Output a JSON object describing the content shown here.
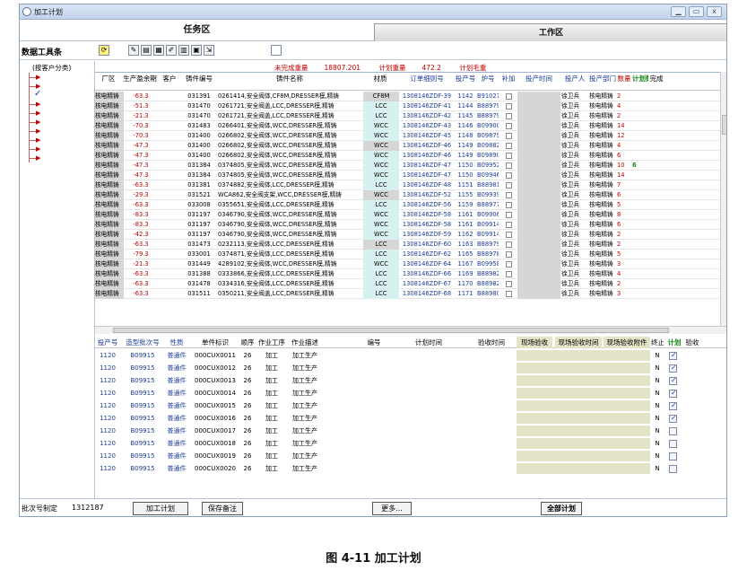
{
  "window": {
    "title": "加工计划",
    "controls": [
      "minimize-icon",
      "restore-icon",
      "close-icon"
    ]
  },
  "panes": {
    "task": "任务区",
    "work": "工作区"
  },
  "toolbar": {
    "label": "数据工具条"
  },
  "tree": {
    "header": "(按客户分类)"
  },
  "summary": {
    "unfinished_label": "未完成重量",
    "unfinished_value": "18807.201",
    "plan_label": "计划重量",
    "plan_value": "472.2",
    "blank_label": "计划毛重"
  },
  "grid1": {
    "headers": [
      "厂区",
      "生产盈余期",
      "客户",
      "铸件编号",
      "铸件名称",
      "材质",
      "订单细则号",
      "投产号",
      "炉号",
      "补加",
      "投产时间",
      "投产人",
      "投产部门",
      "数量",
      "计划数",
      "完成"
    ],
    "rows": [
      {
        "a": "核电精铸",
        "b": "-63.3",
        "d": "031391",
        "e": "0261414,安全阀体,CF8M,DRESSER模,精铸",
        "f": "CF8M",
        "g": "1308146ZDF-39",
        "h": "1142",
        "i": "B91027",
        "l": "徐卫兵",
        "m": "核电精铸",
        "n": "2",
        "o": "",
        "hl": "g"
      },
      {
        "a": "核电精铸",
        "b": "-51.3",
        "d": "031470",
        "e": "0261721,安全阀盖,LCC,DRESSER模,精铸",
        "f": "LCC",
        "g": "1308146ZDF-41",
        "h": "1144",
        "i": "B88979",
        "l": "徐卫兵",
        "m": "核电精铸",
        "n": "4",
        "o": "",
        "hl": "c"
      },
      {
        "a": "核电精铸",
        "b": "-21.3",
        "d": "031470",
        "e": "0261721,安全阀盖,LCC,DRESSER模,精铸",
        "f": "LCC",
        "g": "1308146ZDF-42",
        "h": "1145",
        "i": "B88979",
        "l": "徐卫兵",
        "m": "核电精铸",
        "n": "2",
        "o": "",
        "hl": "c"
      },
      {
        "a": "核电精铸",
        "b": "-70.3",
        "d": "031483",
        "e": "0266401,安全阀体,WCC,DRESSER模,精铸",
        "f": "WCC",
        "g": "1308146ZDF-43",
        "h": "1146",
        "i": "B09900",
        "l": "徐卫兵",
        "m": "核电精铸",
        "n": "14",
        "o": "",
        "hl": "c"
      },
      {
        "a": "核电精铸",
        "b": "-70.3",
        "d": "031400",
        "e": "0266802,安全阀体,WCC,DRESSER模,精铸",
        "f": "WCC",
        "g": "1308146ZDF-45",
        "h": "1148",
        "i": "B09879",
        "l": "徐卫兵",
        "m": "核电精铸",
        "n": "12",
        "o": "",
        "hl": "c"
      },
      {
        "a": "核电精铸",
        "b": "-47.3",
        "d": "031400",
        "e": "0266802,安全阀体,WCC,DRESSER模,精铸",
        "f": "WCC",
        "g": "1308146ZDF-46",
        "h": "1149",
        "i": "B09882",
        "l": "徐卫兵",
        "m": "核电精铸",
        "n": "4",
        "o": "",
        "hl": "g"
      },
      {
        "a": "核电精铸",
        "b": "-47.3",
        "d": "031400",
        "e": "0266802,安全阀体,WCC,DRESSER模,精铸",
        "f": "WCC",
        "g": "1308146ZDF-46",
        "h": "1149",
        "i": "B09890",
        "l": "徐卫兵",
        "m": "核电精铸",
        "n": "6",
        "o": "",
        "hl": "c"
      },
      {
        "a": "核电精铸",
        "b": "-47.3",
        "d": "031384",
        "e": "0374805,安全阀体,WCC,DRESSER模,精铸",
        "f": "WCC",
        "g": "1308146ZDF-47",
        "h": "1150",
        "i": "B09952",
        "l": "徐卫兵",
        "m": "核电精铸",
        "n": "10",
        "o": "6",
        "hl": "c"
      },
      {
        "a": "核电精铸",
        "b": "-47.3",
        "d": "031384",
        "e": "0374805,安全阀体,WCC,DRESSER模,精铸",
        "f": "WCC",
        "g": "1308146ZDF-47",
        "h": "1150",
        "i": "B09946",
        "l": "徐卫兵",
        "m": "核电精铸",
        "n": "14",
        "o": "",
        "hl": "c"
      },
      {
        "a": "核电精铸",
        "b": "-63.3",
        "d": "031381",
        "e": "0374882,安全阀体,LCC,DRESSER模,精铸",
        "f": "LCC",
        "g": "1308146ZDF-48",
        "h": "1151",
        "i": "B88981",
        "l": "徐卫兵",
        "m": "核电精铸",
        "n": "7",
        "o": "",
        "hl": "c"
      },
      {
        "a": "核电精铸",
        "b": "-29.3",
        "d": "031521",
        "e": "WCA862,安全阀支架,WCC,DRESSER模,精铸",
        "f": "WCC",
        "g": "1308146ZDF-52",
        "h": "1155",
        "i": "B09939",
        "l": "徐卫兵",
        "m": "核电精铸",
        "n": "6",
        "o": "",
        "hl": "g"
      },
      {
        "a": "核电精铸",
        "b": "-63.3",
        "d": "033008",
        "e": "0355651,安全阀体,LCC,DRESSER模,精铸",
        "f": "LCC",
        "g": "1308146ZDF-56",
        "h": "1159",
        "i": "B88977",
        "l": "徐卫兵",
        "m": "核电精铸",
        "n": "5",
        "o": "",
        "hl": "c"
      },
      {
        "a": "核电精铸",
        "b": "-83.3",
        "d": "031197",
        "e": "0346790,安全阀体,WCC,DRESSER模,精铸",
        "f": "WCC",
        "g": "1308146ZDF-58",
        "h": "1161",
        "i": "B09906",
        "l": "徐卫兵",
        "m": "核电精铸",
        "n": "8",
        "o": "",
        "hl": "c"
      },
      {
        "a": "核电精铸",
        "b": "-83.3",
        "d": "031197",
        "e": "0346790,安全阀体,WCC,DRESSER模,精铸",
        "f": "WCC",
        "g": "1308146ZDF-58",
        "h": "1161",
        "i": "B09914",
        "l": "徐卫兵",
        "m": "核电精铸",
        "n": "6",
        "o": "",
        "hl": "c"
      },
      {
        "a": "核电精铸",
        "b": "-42.3",
        "d": "031197",
        "e": "0346790,安全阀体,WCC,DRESSER模,精铸",
        "f": "WCC",
        "g": "1308146ZDF-59",
        "h": "1162",
        "i": "B09914",
        "l": "徐卫兵",
        "m": "核电精铸",
        "n": "2",
        "o": "",
        "hl": "c"
      },
      {
        "a": "核电精铸",
        "b": "-63.3",
        "d": "031473",
        "e": "0232113,安全阀体,LCC,DRESSER模,精铸",
        "f": "LCC",
        "g": "1308146ZDF-60",
        "h": "1163",
        "i": "B88979",
        "l": "徐卫兵",
        "m": "核电精铸",
        "n": "2",
        "o": "",
        "hl": "g"
      },
      {
        "a": "核电精铸",
        "b": "-79.3",
        "d": "033001",
        "e": "0374871,安全阀体,LCC,DRESSER模,精铸",
        "f": "LCC",
        "g": "1308146ZDF-62",
        "h": "1165",
        "i": "B88978",
        "l": "徐卫兵",
        "m": "核电精铸",
        "n": "5",
        "o": "",
        "hl": "c"
      },
      {
        "a": "核电精铸",
        "b": "-21.3",
        "d": "031449",
        "e": "4289102,安全阀体,WCC,DRESSER模,精铸",
        "f": "WCC",
        "g": "1308146ZDF-64",
        "h": "1167",
        "i": "B09958",
        "l": "徐卫兵",
        "m": "核电精铸",
        "n": "3",
        "o": "",
        "hl": "c"
      },
      {
        "a": "核电精铸",
        "b": "-63.3",
        "d": "031388",
        "e": "0333866,安全阀体,LCC,DRESSER模,精铸",
        "f": "LCC",
        "g": "1308146ZDF-66",
        "h": "1169",
        "i": "B88982",
        "l": "徐卫兵",
        "m": "核电精铸",
        "n": "4",
        "o": "",
        "hl": "c"
      },
      {
        "a": "核电精铸",
        "b": "-63.3",
        "d": "031478",
        "e": "0334316,安全阀体,LCC,DRESSER模,精铸",
        "f": "LCC",
        "g": "1308146ZDF-67",
        "h": "1170",
        "i": "B88982",
        "l": "徐卫兵",
        "m": "核电精铸",
        "n": "2",
        "o": "",
        "hl": "c"
      },
      {
        "a": "核电精铸",
        "b": "-63.3",
        "d": "031511",
        "e": "0350211,安全阀盖,LCC,DRESSER模,精铸",
        "f": "LCC",
        "g": "1308146ZDF-68",
        "h": "1171",
        "i": "B88980",
        "l": "徐卫兵",
        "m": "核电精铸",
        "n": "3",
        "o": "",
        "hl": "c"
      }
    ]
  },
  "grid2": {
    "headers": [
      "投产号",
      "造型批次号",
      "性质",
      "单件标识",
      "顺序",
      "作业工序",
      "作业描述",
      "编号",
      "计划时间",
      "验收时间",
      "现场验收",
      "现场验收时间",
      "现场验收附件",
      "终止",
      "计划",
      "验收"
    ],
    "rows": [
      {
        "a": "1120",
        "b": "B09915",
        "c": "普通件",
        "d": "000CUX0011",
        "e": "26",
        "f": "加工",
        "g": "加工生产",
        "n": "N",
        "chk": true
      },
      {
        "a": "1120",
        "b": "B09915",
        "c": "普通件",
        "d": "000CUX0012",
        "e": "26",
        "f": "加工",
        "g": "加工生产",
        "n": "N",
        "chk": true
      },
      {
        "a": "1120",
        "b": "B09915",
        "c": "普通件",
        "d": "000CUX0013",
        "e": "26",
        "f": "加工",
        "g": "加工生产",
        "n": "N",
        "chk": true
      },
      {
        "a": "1120",
        "b": "B09915",
        "c": "普通件",
        "d": "000CUX0014",
        "e": "26",
        "f": "加工",
        "g": "加工生产",
        "n": "N",
        "chk": true
      },
      {
        "a": "1120",
        "b": "B09915",
        "c": "普通件",
        "d": "000CUX0015",
        "e": "26",
        "f": "加工",
        "g": "加工生产",
        "n": "N",
        "chk": true
      },
      {
        "a": "1120",
        "b": "B09915",
        "c": "普通件",
        "d": "000CUX0016",
        "e": "26",
        "f": "加工",
        "g": "加工生产",
        "n": "N",
        "chk": true
      },
      {
        "a": "1120",
        "b": "B09915",
        "c": "普通件",
        "d": "000CUX0017",
        "e": "26",
        "f": "加工",
        "g": "加工生产",
        "n": "N",
        "chk": false
      },
      {
        "a": "1120",
        "b": "B09915",
        "c": "普通件",
        "d": "000CUX0018",
        "e": "26",
        "f": "加工",
        "g": "加工生产",
        "n": "N",
        "chk": false
      },
      {
        "a": "1120",
        "b": "B09915",
        "c": "普通件",
        "d": "000CUX0019",
        "e": "26",
        "f": "加工",
        "g": "加工生产",
        "n": "N",
        "chk": false
      },
      {
        "a": "1120",
        "b": "B09915",
        "c": "普通件",
        "d": "000CUX0020",
        "e": "26",
        "f": "加工",
        "g": "加工生产",
        "n": "N",
        "chk": false
      }
    ]
  },
  "bottom": {
    "batch_label": "批次号制定",
    "batch_value": "1312187",
    "btn_plan": "加工计划",
    "btn_save": "保存备注",
    "btn_more": "更多...",
    "btn_all": "全部计划"
  },
  "caption": "图 4-11  加工计划",
  "colors": {
    "highlight_gray": "#d6d6d6",
    "highlight_cyan": "#d7f1f1",
    "red": "#c00000",
    "blue": "#1b3c9a",
    "green": "#1a8a1a"
  }
}
